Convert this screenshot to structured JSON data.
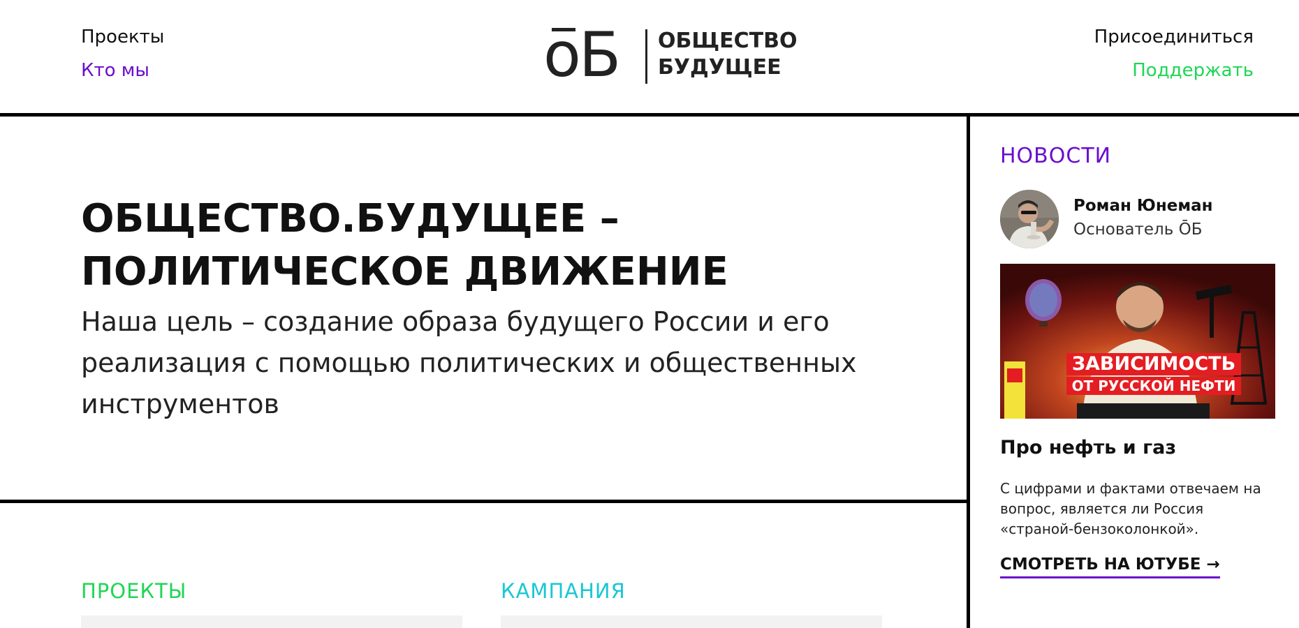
{
  "header": {
    "nav_left": [
      "Проекты",
      "Кто мы"
    ],
    "nav_right": [
      "Присоединиться",
      "Поддержать"
    ],
    "logo": {
      "mark": "ŌБ",
      "line1": "ОБЩЕСТВО",
      "line2": "БУДУЩЕЕ"
    }
  },
  "hero": {
    "title_line1": "ОБЩЕСТВО.БУДУЩЕЕ –",
    "title_line2": "ПОЛИТИЧЕСКОЕ ДВИЖЕНИЕ",
    "subtitle": "Наша цель – создание образа будущего России и его реализация с помощью политических и общественных инструментов"
  },
  "sections": {
    "projects": "ПРОЕКТЫ",
    "campaign": "КАМПАНИЯ"
  },
  "news": {
    "title": "НОВОСТИ",
    "author_name": "Роман Юнеман",
    "author_role": "Основатель ŌБ",
    "image_caption_line1": "ЗАВИСИМОСТЬ",
    "image_caption_line2": "ОТ РУССКОЙ НЕФТИ",
    "headline": "Про нефть и газ",
    "text": "С цифрами и фактами отвечаем на вопрос, является ли Россия «страной-бензоколонкой».",
    "link": "СМОТРЕТЬ НА ЮТУБЕ →"
  },
  "colors": {
    "accent_purple": "#6a0dcf",
    "accent_green": "#1fd655",
    "accent_cyan": "#19c7d3",
    "rule": "#000000"
  }
}
